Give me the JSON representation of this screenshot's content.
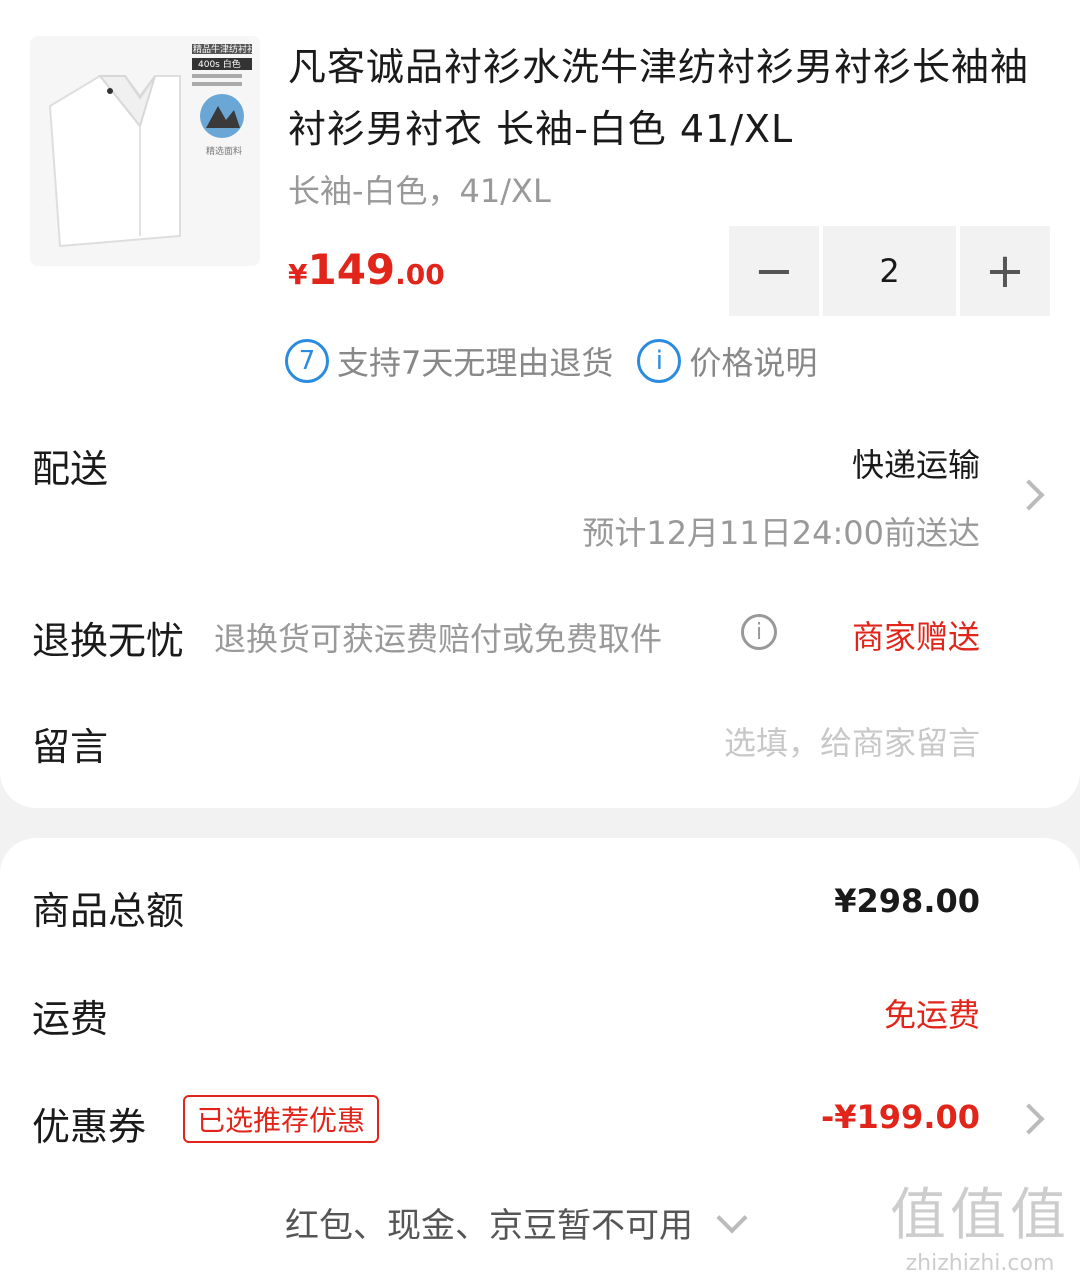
{
  "product": {
    "title": "凡客诚品衬衫水洗牛津纺衬衫男衬衫长袖袖衬衫男衬衣 长袖-白色 41/XL",
    "spec": "长袖-白色，41/XL",
    "price_currency": "¥",
    "price_int": "149",
    "price_dec": ".00",
    "quantity": "2",
    "minus": "−",
    "plus": "+",
    "image_label_1": "精品牛津纺衬衫",
    "image_label_2": "400s 白色",
    "image_label_3": "精选面料"
  },
  "services": {
    "return_icon": "7",
    "return_text": "支持7天无理由退货",
    "price_icon": "i",
    "price_text": "价格说明"
  },
  "delivery": {
    "label": "配送",
    "method": "快递运输",
    "eta": "预计12月11日24:00前送达"
  },
  "return_insurance": {
    "label": "退换无忧",
    "desc": "退换货可获运费赔付或免费取件",
    "info_icon": "i",
    "status": "商家赠送"
  },
  "message": {
    "label": "留言",
    "placeholder": "选填，给商家留言"
  },
  "summary": {
    "goods_total_label": "商品总额",
    "goods_total": "¥298.00",
    "shipping_label": "运费",
    "shipping_value": "免运费",
    "coupon_label": "优惠券",
    "coupon_tag": "已选推荐优惠",
    "coupon_value": "-¥199.00",
    "unavailable": "红包、现金、京豆暂不可用"
  },
  "watermark": {
    "big": "值值值",
    "small": "zhizhizhi.com"
  },
  "colors": {
    "accent_red": "#e1251b",
    "info_blue": "#2a8be0"
  }
}
